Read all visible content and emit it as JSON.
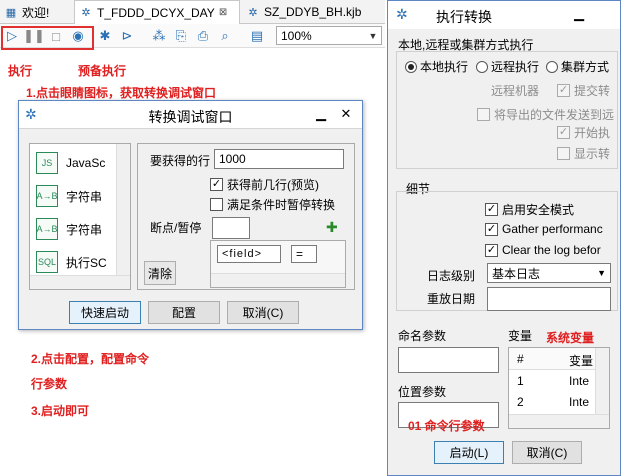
{
  "tabs": [
    {
      "label": "欢迎!",
      "icon": "welcome-icon"
    },
    {
      "label": "T_FDDD_DCYX_DAY",
      "icon": "transformation-icon",
      "close": "⊠"
    },
    {
      "label": "SZ_DDYB_BH.kjb",
      "icon": "job-icon"
    }
  ],
  "toolbar": {
    "zoom": "100%"
  },
  "annotations": {
    "run": "执行",
    "preview": "预备执行",
    "step1": "1.点击眼睛图标，获取转换调试窗口",
    "step2a": "2.点击配置，配置命令",
    "step2b": "行参数",
    "step3": "3.启动即可",
    "sysvar": "系统变量",
    "cmdparam": "01 命令行参数"
  },
  "debug_dialog": {
    "title": "转换调试窗口",
    "steps": [
      {
        "label": "JavaSc",
        "icon": "js-step-icon"
      },
      {
        "label": "字符串",
        "icon": "string-step-icon"
      },
      {
        "label": "字符串",
        "icon": "string-step-icon"
      },
      {
        "label": "执行SC",
        "icon": "sql-step-icon"
      }
    ],
    "rows_label": "要获得的行",
    "rows_value": "1000",
    "get_before_label": "获得前几行(预览)",
    "pause_label": "满足条件时暂停转换",
    "breakpoint_label": "断点/暂停",
    "field_placeholder": "<field>",
    "op_value": "=",
    "clear_label": "清除",
    "quick_start_label": "快速启动",
    "configure_label": "配置",
    "cancel_label": "取消(C)"
  },
  "exec_dialog": {
    "title": "执行转换",
    "exec_group_label": "本地,远程或集群方式执行",
    "local_label": "本地执行",
    "remote_label": "远程执行",
    "cluster_label": "集群方式",
    "remote_machine_label": "远程机器",
    "submit_label": "提交转",
    "send_files_label": "将导出的文件发送到远",
    "start_label": "开始执",
    "show_label": "显示转",
    "details_label": "细节",
    "safe_mode_label": "启用安全模式",
    "gather_label": "Gather performanc",
    "clear_log_label": "Clear the log befor",
    "log_level_label": "日志级别",
    "log_level_value": "基本日志",
    "replay_label": "重放日期",
    "named_params_label": "命名参数",
    "variables_label": "变量",
    "var_col_hash": "#",
    "var_col_name": "变量",
    "var_rows": [
      {
        "n": "1",
        "v": "Inte"
      },
      {
        "n": "2",
        "v": "Inte"
      }
    ],
    "position_params_label": "位置参数",
    "launch_label": "启动(L)",
    "cancel_label": "取消(C)"
  }
}
